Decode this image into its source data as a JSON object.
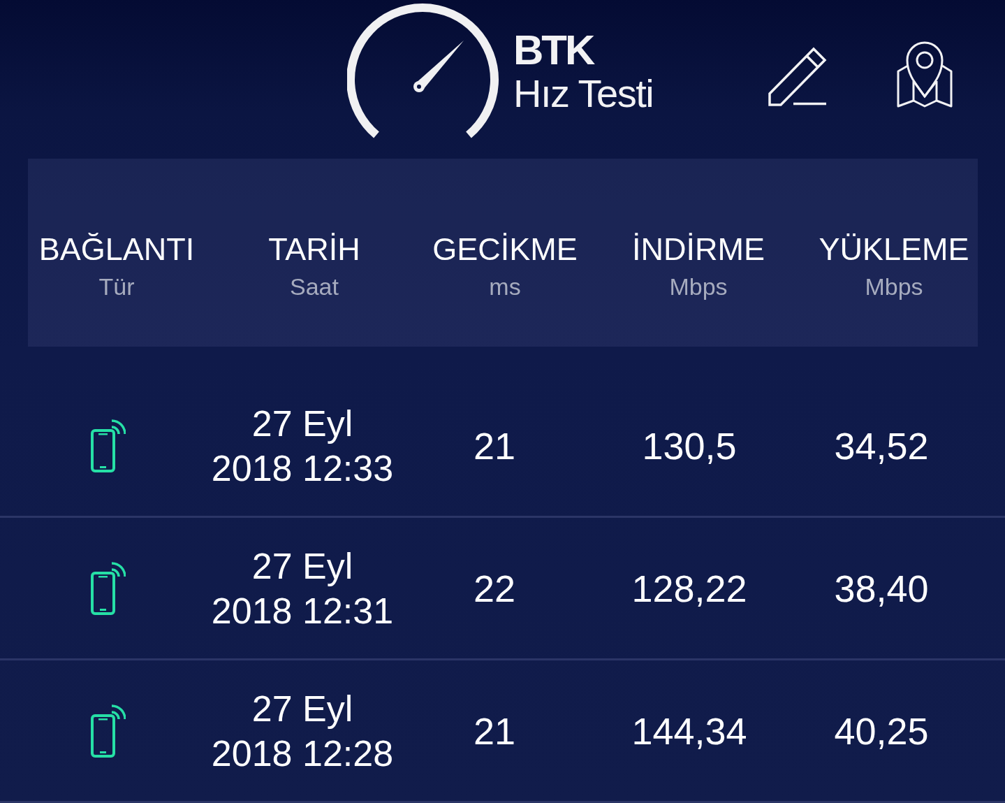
{
  "header": {
    "logo": {
      "title": "BTK",
      "subtitle": "Hız Testi"
    }
  },
  "table": {
    "columns": [
      {
        "label": "BAĞLANTI",
        "unit": "Tür"
      },
      {
        "label": "TARİH",
        "unit": "Saat"
      },
      {
        "label": "GECİKME",
        "unit": "ms"
      },
      {
        "label": "İNDİRME",
        "unit": "Mbps"
      },
      {
        "label": "YÜKLEME",
        "unit": "Mbps"
      }
    ],
    "rows": [
      {
        "kind": "mobile",
        "date": "27 Eyl",
        "time": "2018 12:33",
        "latency": "21",
        "download": "130,5",
        "upload": "34,52"
      },
      {
        "kind": "mobile",
        "date": "27 Eyl",
        "time": "2018 12:31",
        "latency": "22",
        "download": "128,22",
        "upload": "38,40"
      },
      {
        "kind": "mobile",
        "date": "27 Eyl",
        "time": "2018 12:28",
        "latency": "21",
        "download": "144,34",
        "upload": "40,25"
      }
    ]
  }
}
